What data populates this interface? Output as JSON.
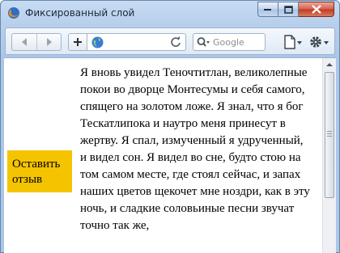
{
  "window": {
    "title": "Фиксированный слой",
    "icon": "firefox-icon"
  },
  "toolbar": {
    "back_icon": "back-arrow-icon",
    "forward_icon": "forward-arrow-icon",
    "add_icon": "plus-icon",
    "url_value": "",
    "search_placeholder": "Google",
    "page_menu_icon": "page-icon",
    "tools_menu_icon": "gear-icon"
  },
  "page": {
    "feedback_label": "Оставить отзыв",
    "feedback_color": "#f5c400",
    "article_text": "Я вновь увидел Теночтитлан, великолепные покои во дворце Монтесумы и себя самого, спящего на золотом ложе. Я знал, что я бог Тескатлипока и наутро меня принесут в жертву. Я спал, измученный я удрученный, и видел сон. Я видел во сне, будто стою на том самом месте, где стоял сейчас, и запах наших цветов щекочет мне ноздри, как в эту ночь, и сладкие соловьиные песни звучат точно так же,"
  }
}
